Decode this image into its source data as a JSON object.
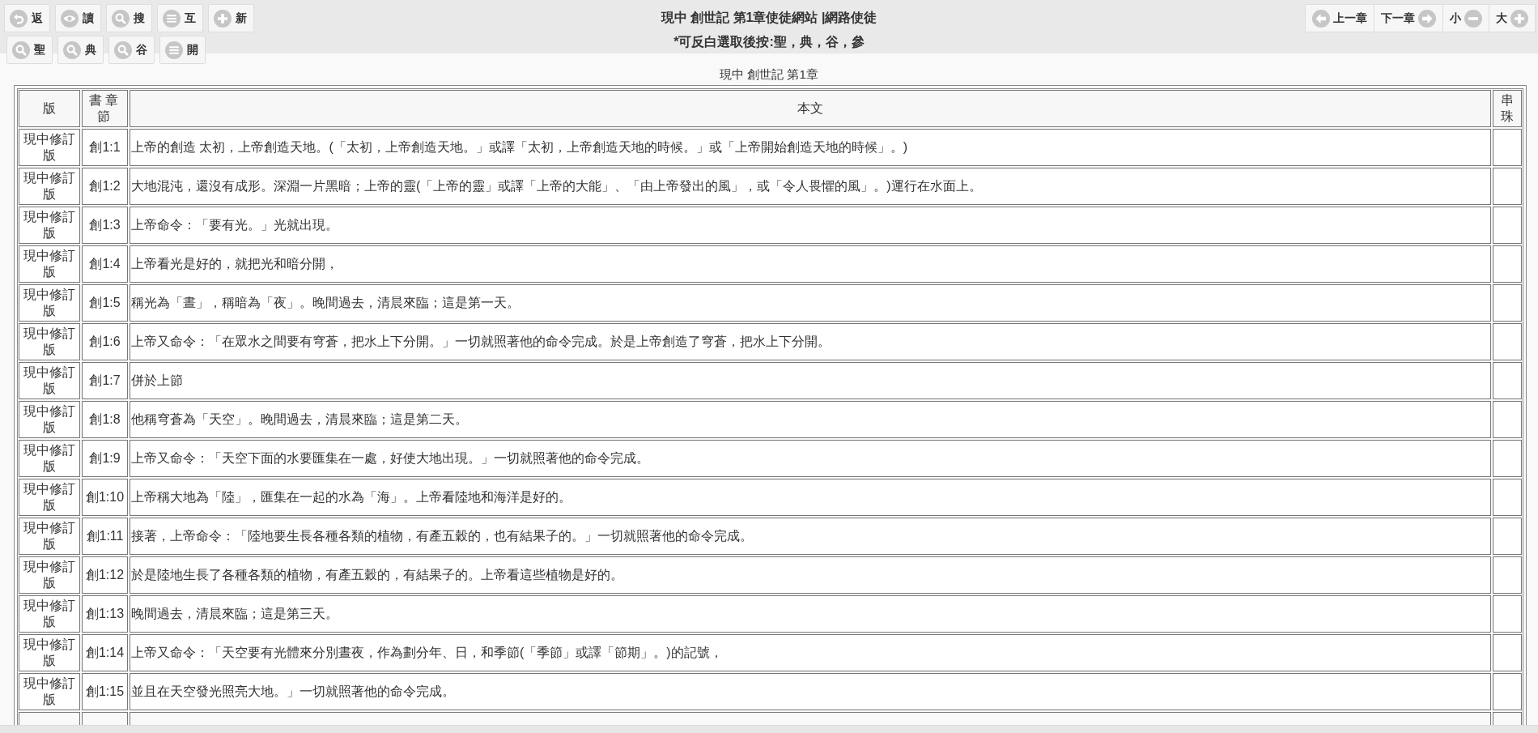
{
  "toolbar_rows": [
    [
      {
        "label": "返",
        "kind": "undo"
      },
      {
        "label": "讀",
        "kind": "eye"
      },
      {
        "label": "搜",
        "kind": "search"
      },
      {
        "label": "互",
        "kind": "menu"
      },
      {
        "label": "新",
        "kind": "plus"
      }
    ],
    [
      {
        "label": "聖",
        "kind": "search"
      },
      {
        "label": "典",
        "kind": "search"
      },
      {
        "label": "谷",
        "kind": "search"
      },
      {
        "label": "開",
        "kind": "menu"
      }
    ]
  ],
  "page_title": "現中 創世記 第1章使徒網站 |網路使徒",
  "hint": "*可反白選取後按:聖，典，谷，參",
  "nav_buttons": [
    {
      "label": "上一章",
      "kind": "prev"
    },
    {
      "label": "下一章",
      "kind": "next"
    },
    {
      "label": "小",
      "kind": "smaller"
    },
    {
      "label": "大",
      "kind": "bigger"
    }
  ],
  "caption": "現中 創世記 第1章",
  "table": {
    "columns": [
      "版",
      "書章節",
      "本文",
      "串珠"
    ],
    "rows": [
      {
        "version": "現中修訂版",
        "ref": "創1:1",
        "text": "上帝的創造 太初，上帝創造天地。(「太初，上帝創造天地。」或譯「太初，上帝創造天地的時候。」或「上帝開始創造天地的時候」。)"
      },
      {
        "version": "現中修訂版",
        "ref": "創1:2",
        "text": "大地混沌，還沒有成形。深淵一片黑暗；上帝的靈(「上帝的靈」或譯「上帝的大能」、「由上帝發出的風」，或「令人畏懼的風」。)運行在水面上。"
      },
      {
        "version": "現中修訂版",
        "ref": "創1:3",
        "text": "上帝命令：「要有光。」光就出現。"
      },
      {
        "version": "現中修訂版",
        "ref": "創1:4",
        "text": "上帝看光是好的，就把光和暗分開，"
      },
      {
        "version": "現中修訂版",
        "ref": "創1:5",
        "text": "稱光為「晝」，稱暗為「夜」。晚間過去，清晨來臨；這是第一天。"
      },
      {
        "version": "現中修訂版",
        "ref": "創1:6",
        "text": "上帝又命令：「在眾水之間要有穹蒼，把水上下分開。」一切就照著他的命令完成。於是上帝創造了穹蒼，把水上下分開。"
      },
      {
        "version": "現中修訂版",
        "ref": "創1:7",
        "text": "併於上節"
      },
      {
        "version": "現中修訂版",
        "ref": "創1:8",
        "text": "他稱穹蒼為「天空」。晚間過去，清晨來臨；這是第二天。"
      },
      {
        "version": "現中修訂版",
        "ref": "創1:9",
        "text": "上帝又命令：「天空下面的水要匯集在一處，好使大地出現。」一切就照著他的命令完成。"
      },
      {
        "version": "現中修訂版",
        "ref": "創1:10",
        "text": "上帝稱大地為「陸」，匯集在一起的水為「海」。上帝看陸地和海洋是好的。"
      },
      {
        "version": "現中修訂版",
        "ref": "創1:11",
        "text": "接著，上帝命令：「陸地要生長各種各類的植物，有產五穀的，也有結果子的。」一切就照著他的命令完成。"
      },
      {
        "version": "現中修訂版",
        "ref": "創1:12",
        "text": "於是陸地生長了各種各類的植物，有產五穀的，有結果子的。上帝看這些植物是好的。"
      },
      {
        "version": "現中修訂版",
        "ref": "創1:13",
        "text": "晚間過去，清晨來臨；這是第三天。"
      },
      {
        "version": "現中修訂版",
        "ref": "創1:14",
        "text": "上帝又命令：「天空要有光體來分別晝夜，作為劃分年、日，和季節(「季節」或譯「節期」。)的記號，"
      },
      {
        "version": "現中修訂版",
        "ref": "創1:15",
        "text": "並且在天空發光照亮大地。」一切就照著他的命令完成。"
      }
    ]
  }
}
